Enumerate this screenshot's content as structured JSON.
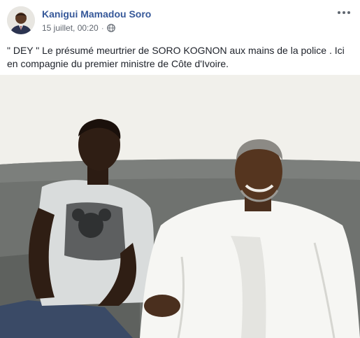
{
  "post": {
    "author": "Kanigui Mamadou Soro",
    "timestamp": "15 juillet, 00:20",
    "separator": "·",
    "privacy_icon": "globe-icon",
    "more_icon": "more-options-icon",
    "text_line1": "\" DEY \" Le présumé meurtrier de SORO KOGNON aux mains de la police . Ici",
    "text_line2": "en compagnie du premier ministre de Côte d'Ivoire."
  },
  "colors": {
    "author_link": "#365899",
    "meta_text": "#616770",
    "body_text": "#1d2129"
  }
}
